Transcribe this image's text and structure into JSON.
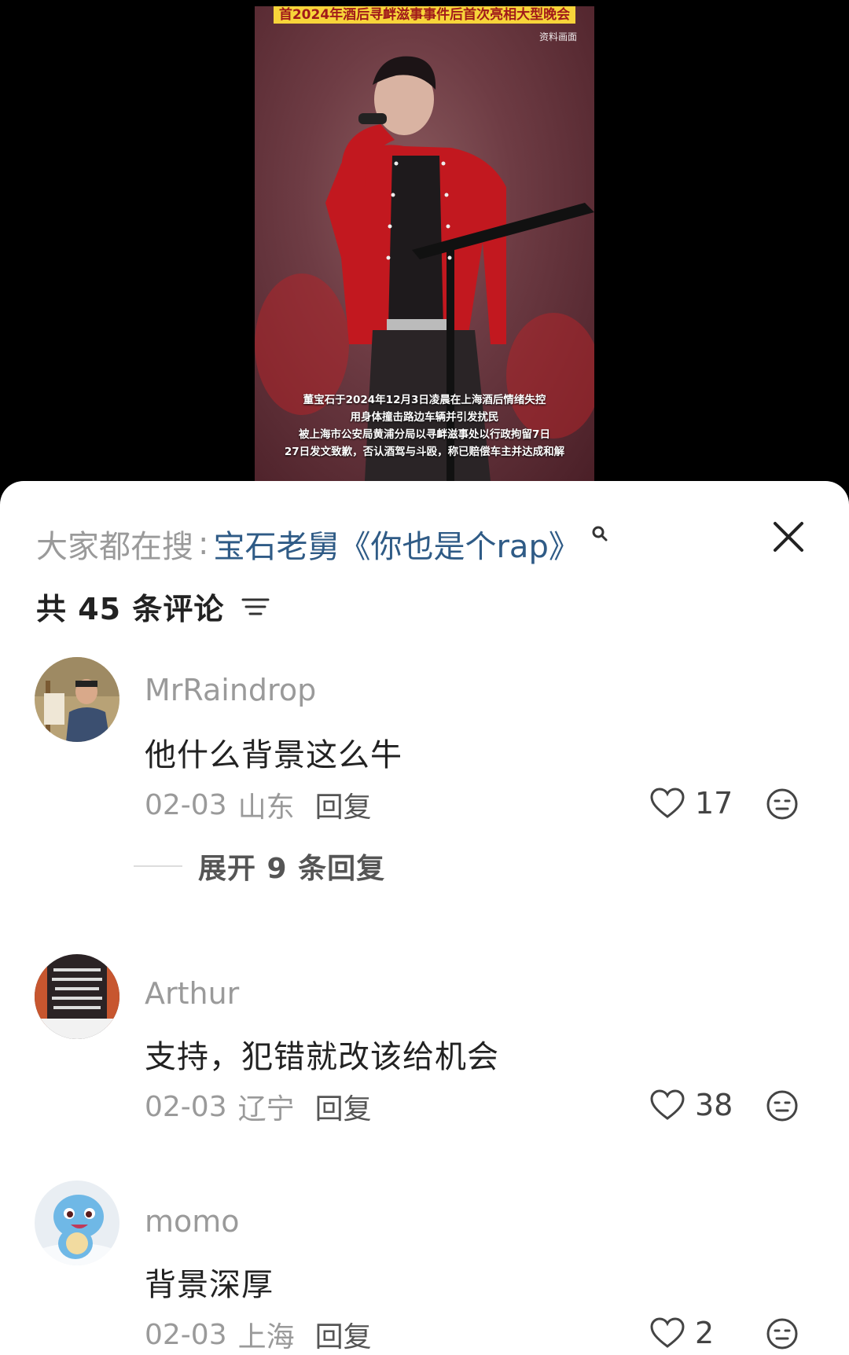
{
  "video": {
    "headline": "首2024年酒后寻衅滋事事件后首次亮相大型晚会",
    "source_tag": "资料画面",
    "caption_lines": [
      "董宝石于2024年12月3日凌晨在上海酒后情绪失控",
      "用身体撞击路边车辆并引发扰民",
      "被上海市公安局黄浦分局以寻衅滋事处以行政拘留7日",
      "27日发文致歉，否认酒驾与斗殴，称已赔偿车主并达成和解"
    ]
  },
  "search": {
    "prefix": "大家都在搜",
    "colon": ":",
    "term": "宝石老舅《你也是个rap》"
  },
  "comments_header": {
    "count_label": "共 45 条评论"
  },
  "comments": [
    {
      "username": "MrRaindrop",
      "text": "他什么背景这么牛",
      "date": "02-03",
      "location": "山东",
      "reply_label": "回复",
      "likes": "17",
      "expand_label": "展开 9 条回复"
    },
    {
      "username": "Arthur",
      "text": "支持，犯错就改该给机会",
      "date": "02-03",
      "location": "辽宁",
      "reply_label": "回复",
      "likes": "38"
    },
    {
      "username": "momo",
      "text": "背景深厚",
      "date": "02-03",
      "location": "上海",
      "reply_label": "回复",
      "likes": "2"
    }
  ],
  "colors": {
    "search_term": "#2f5b86",
    "muted_text": "#9a9a9a",
    "headline_bg": "#f7d43a"
  }
}
